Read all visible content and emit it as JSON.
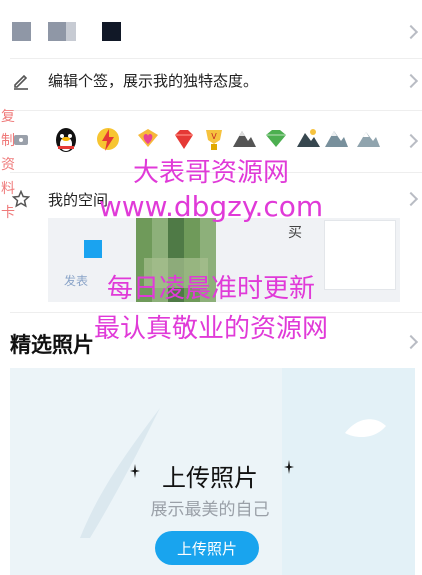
{
  "profile": {
    "color_swatches": [
      "#8f97a6",
      "#8f97a6",
      "#111827"
    ],
    "signature_placeholder": "编辑个签，展示我的独特态度。",
    "badges": [
      "qq-penguin",
      "lightning",
      "heart-gem",
      "ruby",
      "trophy",
      "mountain-grey",
      "diamond-green",
      "mountain-dark",
      "mountain-silver",
      "mountain-light"
    ]
  },
  "side_label": [
    "复",
    "制",
    "资",
    "料",
    "卡"
  ],
  "space": {
    "title": "我的空间",
    "snippet_char": "买",
    "snippet_left": "发表"
  },
  "watermark": {
    "line1": "大表哥资源网",
    "line2": "www.dbgzy.com",
    "line3": "每日凌晨准时更新",
    "line4": "最认真敬业的资源网"
  },
  "photos": {
    "title": "精选照片",
    "upload_title": "上传照片",
    "upload_subtitle": "展示最美的自己",
    "upload_button": "上传照片"
  }
}
